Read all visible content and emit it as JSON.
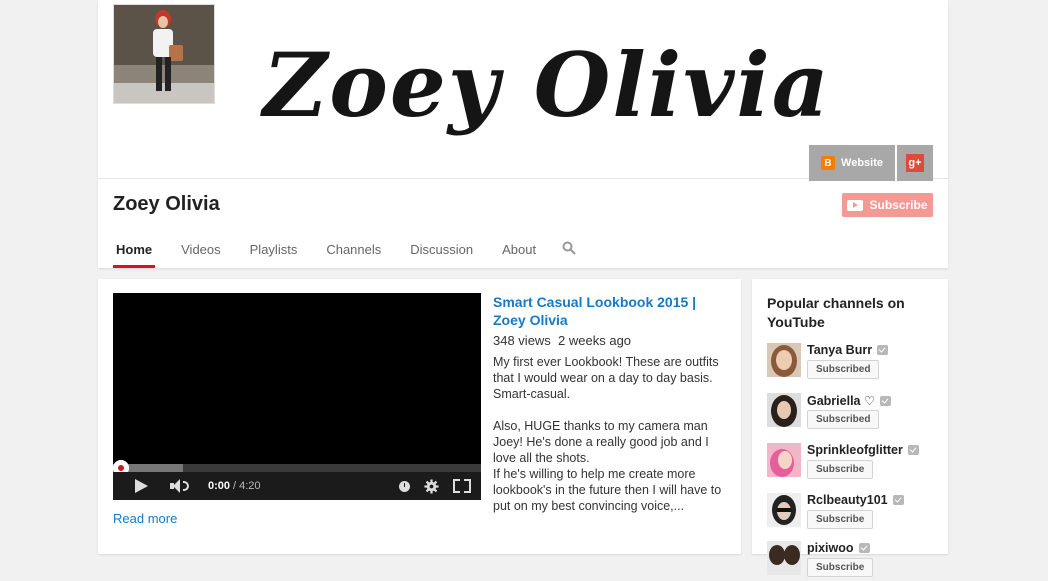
{
  "channel": {
    "banner_title": "Zoey Olivia",
    "name": "Zoey Olivia",
    "links": [
      {
        "label": "Website",
        "icon": "blogger-icon"
      },
      {
        "label": "",
        "icon": "google-plus-icon",
        "glyph": "g+"
      }
    ],
    "subscribe_label": "Subscribe"
  },
  "tabs": [
    {
      "label": "Home",
      "active": true
    },
    {
      "label": "Videos"
    },
    {
      "label": "Playlists"
    },
    {
      "label": "Channels"
    },
    {
      "label": "Discussion"
    },
    {
      "label": "About"
    }
  ],
  "featured_video": {
    "title": "Smart Casual Lookbook 2015 | Zoey Olivia",
    "views": "348 views",
    "age": "2 weeks ago",
    "description": "My first ever Lookbook! These are outfits that I would wear on a day to day basis. Smart-casual.\n\nAlso, HUGE thanks to my camera man Joey! He's done a really good job and I love all the shots.\nIf he's willing to help me create more lookbook's in the future then I will have to put on my best convincing voice,...",
    "player": {
      "current_time": "0:00",
      "separator": "/",
      "duration": "4:20",
      "loaded_fraction": 0.19
    },
    "read_more": "Read more"
  },
  "sidebar": {
    "title": "Popular channels on YouTube",
    "channels": [
      {
        "name": "Tanya Burr",
        "button": "Subscribed"
      },
      {
        "name": "Gabriella ♡",
        "button": "Subscribed"
      },
      {
        "name": "Sprinkleofglitter",
        "button": "Subscribe"
      },
      {
        "name": "Rclbeauty101",
        "button": "Subscribe"
      },
      {
        "name": "pixiwoo",
        "button": "Subscribe"
      }
    ]
  },
  "colors": {
    "accent_red": "#cc181e",
    "link_blue": "#167ac6",
    "blogger_orange": "#f57d00",
    "gplus_red": "#dd4b39"
  }
}
